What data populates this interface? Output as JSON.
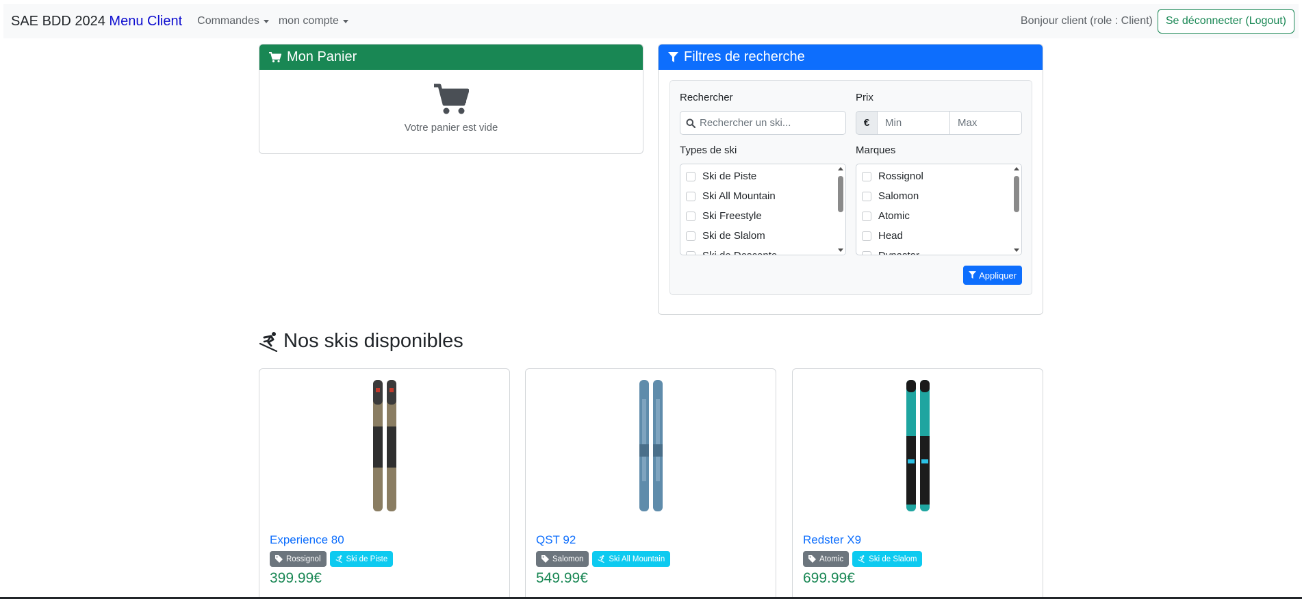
{
  "navbar": {
    "brand": "SAE BDD 2024",
    "brand_link": "Menu Client",
    "menus": [
      "Commandes",
      "mon compte"
    ],
    "greeting": "Bonjour client (role : Client)",
    "logout": "Se déconnecter (Logout)"
  },
  "cart": {
    "title": "Mon Panier",
    "empty_text": "Votre panier est vide"
  },
  "filters": {
    "title": "Filtres de recherche",
    "search_label": "Rechercher",
    "search_placeholder": "Rechercher un ski...",
    "price_label": "Prix",
    "currency": "€",
    "min_placeholder": "Min",
    "max_placeholder": "Max",
    "types_label": "Types de ski",
    "types": [
      "Ski de Piste",
      "Ski All Mountain",
      "Ski Freestyle",
      "Ski de Slalom",
      "Ski de Descente"
    ],
    "brands_label": "Marques",
    "brands": [
      "Rossignol",
      "Salomon",
      "Atomic",
      "Head",
      "Dynastar"
    ],
    "apply": "Appliquer"
  },
  "products_title": "Nos skis disponibles",
  "products": [
    {
      "name": "Experience 80",
      "brand": "Rossignol",
      "type": "Ski de Piste",
      "price": "399.99€"
    },
    {
      "name": "QST 92",
      "brand": "Salomon",
      "type": "Ski All Mountain",
      "price": "549.99€"
    },
    {
      "name": "Redster X9",
      "brand": "Atomic",
      "type": "Ski de Slalom",
      "price": "699.99€"
    }
  ],
  "colors": {
    "success": "#198754",
    "primary": "#0d6efd",
    "secondary": "#6c757d",
    "info": "#0dcaf0"
  }
}
